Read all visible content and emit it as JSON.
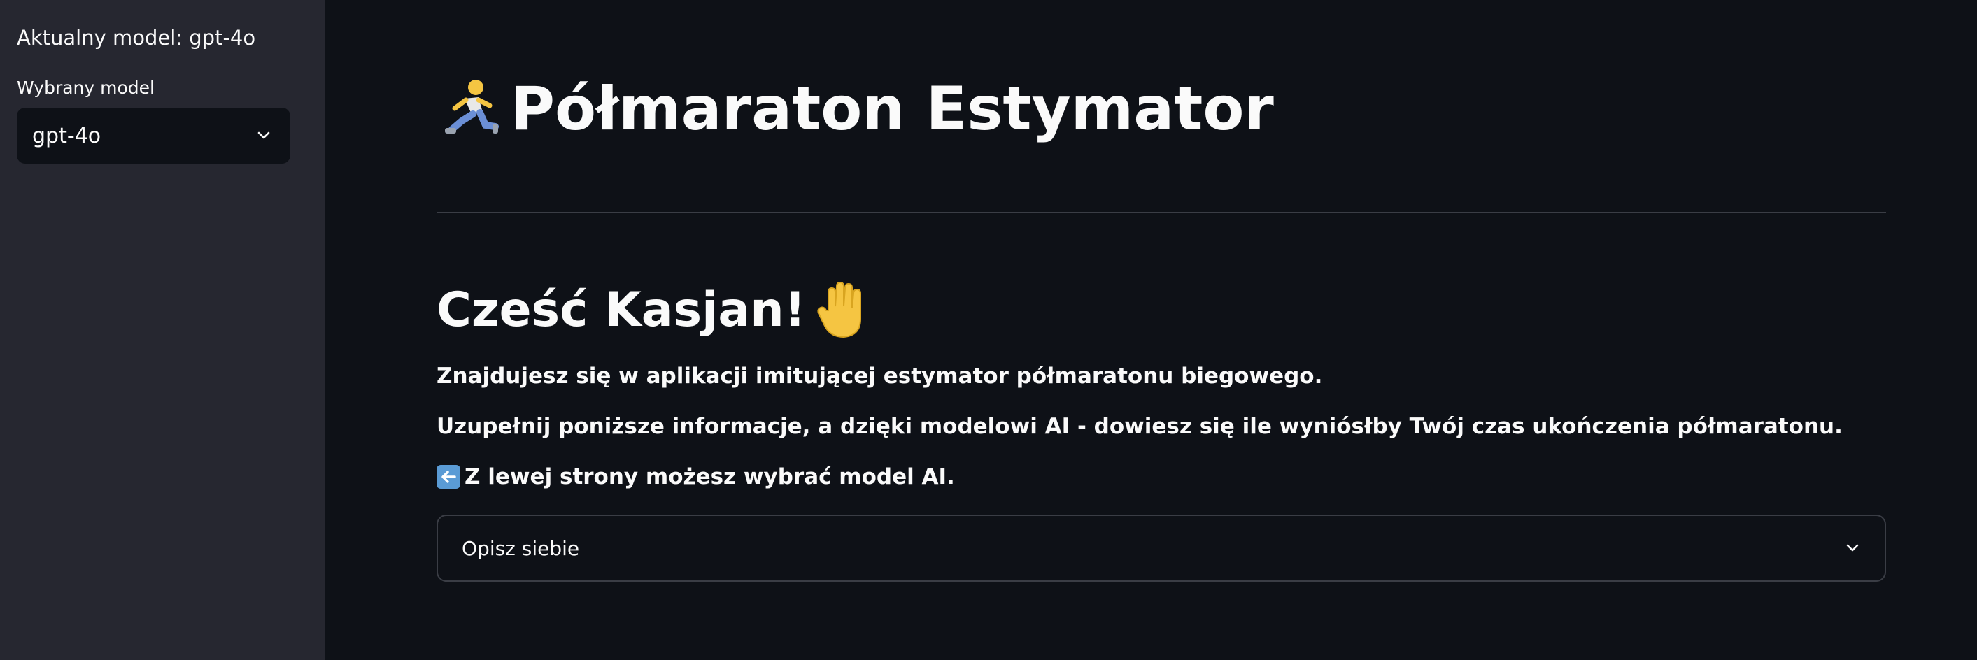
{
  "sidebar": {
    "current_model_text": "Aktualny model: gpt-4o",
    "select_label": "Wybrany model",
    "select_value": "gpt-4o"
  },
  "main": {
    "title_icon": "runner-icon",
    "title": "Półmaraton Estymator",
    "greeting": "Cześć Kasjan!",
    "greeting_icon": "raised-hand-icon",
    "paragraph_1": "Znajdujesz się w aplikacji imitującej estymator półmaratonu biegowego.",
    "paragraph_2": "Uzupełnij poniższe informacje, a dzięki modelowi AI - dowiesz się ile wyniósłby Twój czas ukończenia półmaratonu.",
    "paragraph_3_icon": "left-arrow-icon",
    "paragraph_3": "Z lewej strony możesz wybrać model AI.",
    "expander_label": "Opisz siebie"
  },
  "colors": {
    "background": "#0e1117",
    "sidebar_background": "#262730",
    "text": "#fafafa",
    "border": "#3a3d45",
    "arrow_badge": "#5a9bd5"
  }
}
